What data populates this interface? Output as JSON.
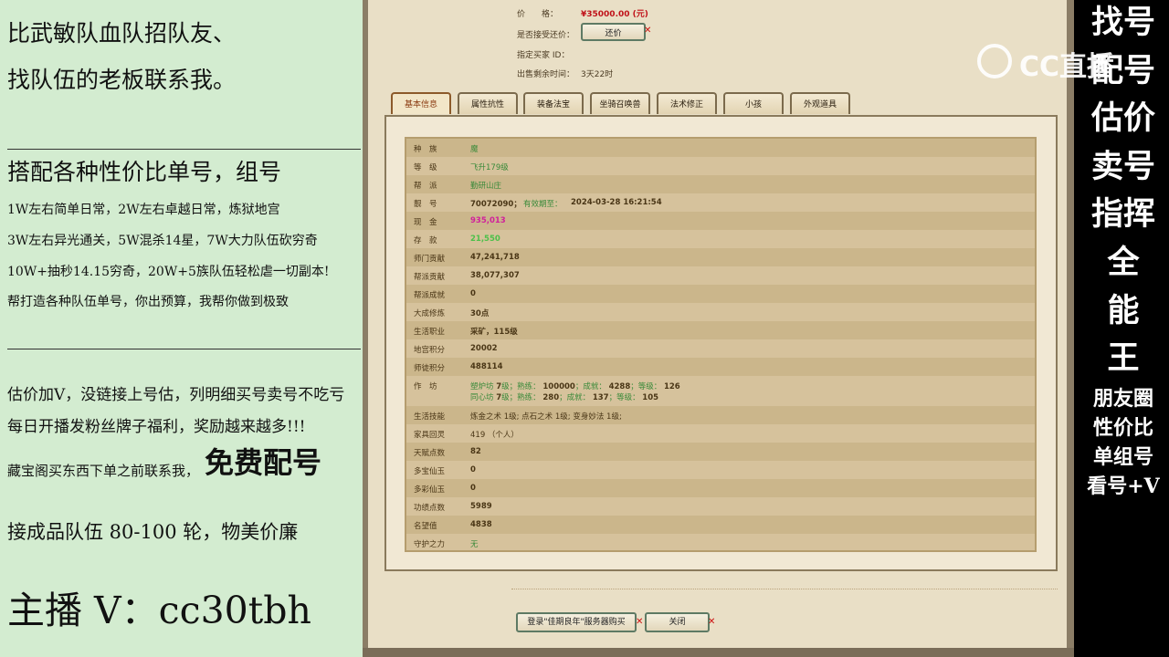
{
  "left": {
    "line1": "比武敏队血队招队友、",
    "line2": "找队伍的老板联系我。",
    "heading2": "搭配各种性价比单号，组号",
    "item1": "1W左右简单日常，2W左右卓越日常，炼狱地宫",
    "item2": "3W左右异光通关，5W混杀14星，7W大力队伍砍穷奇",
    "item3": "10W+抽秒14.15穷奇，20W+5族队伍轻松虐一切副本!",
    "item4": "帮打造各种队伍单号，你出预算，我帮你做到极致",
    "p1": "估价加V，没链接上号估，列明细买号卖号不吃亏",
    "p2": "每日开播发粉丝牌子福利，奖励越来越多!!!",
    "p3_small": "藏宝阁买东西下单之前联系我，",
    "p3_big": "免费配号",
    "p4": "接成品队伍 80-100 轮，物美价廉",
    "host": "主播 V：cc30tbh"
  },
  "info": {
    "price_label": "价　　格：",
    "price_value": "¥35000.00 (元)",
    "counter_label": "是否接受还价：",
    "counter_button": "还价",
    "buyer_label": "指定买家 ID：",
    "time_label": "出售剩余时间：",
    "time_value": "3天22时"
  },
  "tabs": [
    "基本信息",
    "属性抗性",
    "装备法宝",
    "坐骑召唤兽",
    "法术修正",
    "小孩",
    "外观道具"
  ],
  "rows": [
    {
      "label": "种　族",
      "value": "魔"
    },
    {
      "label": "等　级",
      "value": "飞升179级"
    },
    {
      "label": "帮　派",
      "value": "勤研山庄"
    },
    {
      "label": "靓　号",
      "value": "70072090；",
      "extra_label": "有效期至：",
      "extra_value": "2024-03-28 16:21:54"
    },
    {
      "label": "现　金",
      "value": "935,013"
    },
    {
      "label": "存　款",
      "value": "21,550"
    },
    {
      "label": "师门贡献",
      "value": "47,241,718"
    },
    {
      "label": "帮派贡献",
      "value": "38,077,307"
    },
    {
      "label": "帮派成就",
      "value": "0"
    },
    {
      "label": "大成修炼",
      "value": "30点"
    },
    {
      "label": "生活职业",
      "value": "采矿，115级"
    },
    {
      "label": "地宫积分",
      "value": "20002"
    },
    {
      "label": "师徒积分",
      "value": "488114"
    },
    {
      "label": "作　坊",
      "w1_name": "塑炉坊",
      "w1_lv": "7",
      "w1_lvl": "级；熟练：",
      "w1_exp": "100000",
      "w1_c": "；成就：",
      "w1_cv": "4288",
      "w1_g": "；等级：",
      "w1_gv": "126",
      "w2_name": "同心坊",
      "w2_lv": "7",
      "w2_lvl": "级；熟练：",
      "w2_exp": "280",
      "w2_c": "；成就：",
      "w2_cv": "137",
      "w2_g": "；等级：",
      "w2_gv": "105"
    },
    {
      "label": "生活技能",
      "value": "炼金之术 1级; 点石之术 1级; 变身妙法 1级;"
    },
    {
      "label": "家具回灵",
      "value": "419 （个人）"
    },
    {
      "label": "天赋点数",
      "value": "82"
    },
    {
      "label": "多宝仙玉",
      "value": "0"
    },
    {
      "label": "多彩仙玉",
      "value": "0"
    },
    {
      "label": "功绩点数",
      "value": "5989"
    },
    {
      "label": "名望值",
      "value": "4838"
    },
    {
      "label": "守护之力",
      "value": "无"
    }
  ],
  "buttons": {
    "login": "登录\"佳期良年\"服务器购买",
    "close": "关闭"
  },
  "right": {
    "big_lines": [
      "找号",
      "配号",
      "估价",
      "卖号",
      "指挥",
      "全",
      "能",
      "王"
    ],
    "small_lines": [
      "朋友圈",
      "性价比",
      "单组号",
      "看号+V"
    ],
    "logo_text": "CC直播"
  }
}
